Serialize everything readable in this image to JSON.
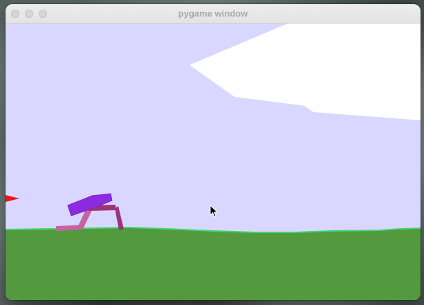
{
  "window": {
    "title": "pygame window"
  },
  "colors": {
    "sky": "#d9d7ff",
    "terrain": "#539a3f",
    "terrain_edge": "#3fd56f",
    "cloud": "#ffffff",
    "hull": "#8c2be0",
    "hull_outline": "#7a22c8",
    "leg_front": "#9b3578",
    "leg_back": "#c6649f",
    "lidar_flag": "#e8161a"
  },
  "icons": {
    "cursor": "arrow-cursor-icon",
    "flag": "lidar-flag-icon"
  }
}
